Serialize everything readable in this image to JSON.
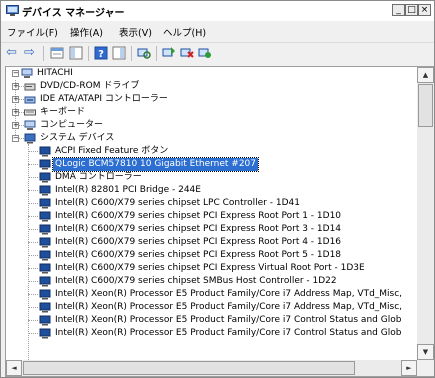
{
  "window": {
    "title": "デバイス マネージャー",
    "minimize_glyph": "_",
    "maximize_glyph": "□",
    "close_glyph": "×"
  },
  "menu": {
    "file": "ファイル(F)",
    "action": "操作(A)",
    "view": "表示(V)",
    "help": "ヘルプ(H)"
  },
  "toolbar": {
    "back_glyph": "⇦",
    "forward_glyph": "⇨"
  },
  "tree": {
    "root": "HITACHI",
    "dvd": "DVD/CD-ROM ドライブ",
    "ide": "IDE ATA/ATAPI コントローラー",
    "keyboard": "キーボード",
    "computer": "コンピューター",
    "system_devices": "システム デバイス",
    "children": [
      "ACPI Fixed Feature ボタン",
      "QLogic BCM57810 10 Gigabit Ethernet #207",
      "DMA コントローラー",
      "Intel(R) 82801 PCI Bridge - 244E",
      "Intel(R) C600/X79 series chipset LPC Controller - 1D41",
      "Intel(R) C600/X79 series chipset PCI Express Root Port 1 - 1D10",
      "Intel(R) C600/X79 series chipset PCI Express Root Port 3 - 1D14",
      "Intel(R) C600/X79 series chipset PCI Express Root Port 4 - 1D16",
      "Intel(R) C600/X79 series chipset PCI Express Root Port 5 - 1D18",
      "Intel(R) C600/X79 series chipset PCI Express Virtual Root Port - 1D3E",
      "Intel(R) C600/X79 series chipset SMBus Host Controller - 1D22",
      "Intel(R) Xeon(R) Processor E5 Product Family/Core i7 Address Map, VTd_Misc,",
      "Intel(R) Xeon(R) Processor E5 Product Family/Core i7 Address Map, VTd_Misc,",
      "Intel(R) Xeon(R) Processor E5 Product Family/Core i7 Control Status and Glob",
      "Intel(R) Xeon(R) Processor E5 Product Family/Core i7 Control Status and Glob"
    ],
    "selected_index": 1,
    "expand_plus": "+",
    "expand_minus": "−"
  },
  "scrollbar": {
    "up_glyph": "▲",
    "down_glyph": "▼",
    "left_glyph": "◄",
    "right_glyph": "►"
  },
  "colors": {
    "selection": "#2c6fd0",
    "device_icon": "#1f4f9c"
  }
}
